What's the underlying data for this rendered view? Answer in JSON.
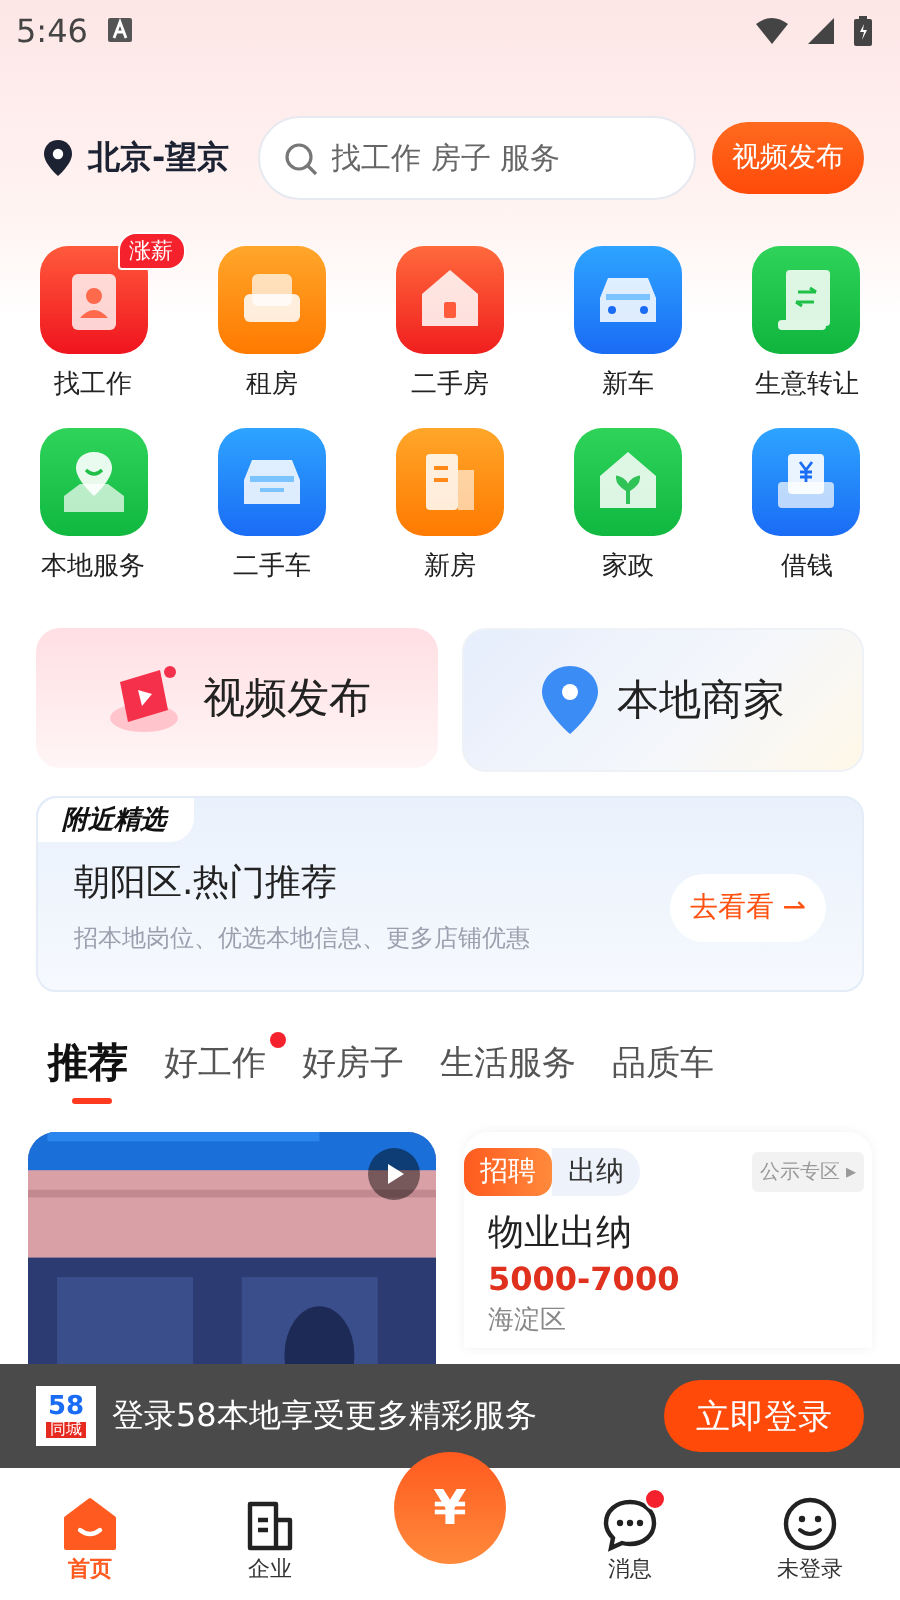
{
  "status_bar": {
    "time": "5:46"
  },
  "header": {
    "location": "北京-望京",
    "search": {
      "placeholder": "找工作 房子 服务"
    },
    "publish_button": "视频发布"
  },
  "services": [
    {
      "label": "找工作",
      "kind": "job",
      "badge": "涨薪"
    },
    {
      "label": "租房",
      "kind": "rent"
    },
    {
      "label": "二手房",
      "kind": "house"
    },
    {
      "label": "新车",
      "kind": "car"
    },
    {
      "label": "生意转让",
      "kind": "transfer"
    },
    {
      "label": "本地服务",
      "kind": "local"
    },
    {
      "label": "二手车",
      "kind": "usedcar"
    },
    {
      "label": "新房",
      "kind": "newhouse"
    },
    {
      "label": "家政",
      "kind": "homecare"
    },
    {
      "label": "借钱",
      "kind": "loan"
    }
  ],
  "feature_cards": [
    {
      "label": "视频发布",
      "kind": "video"
    },
    {
      "label": "本地商家",
      "kind": "merchant"
    }
  ],
  "nearby": {
    "tag": "附近精选",
    "title": "朝阳区.热门推荐",
    "subtitle": "招本地岗位、优选本地信息、更多店铺优惠",
    "action": "去看看 ⇀"
  },
  "tabs": [
    {
      "label": "推荐",
      "selected": true,
      "dot": false
    },
    {
      "label": "好工作",
      "selected": false,
      "dot": true
    },
    {
      "label": "好房子",
      "selected": false,
      "dot": false
    },
    {
      "label": "生活服务",
      "selected": false,
      "dot": false
    },
    {
      "label": "品质车",
      "selected": false,
      "dot": false
    }
  ],
  "feed": {
    "job": {
      "tags": [
        "招聘",
        "出纳"
      ],
      "zone": "公示专区 ▸",
      "title": "物业出纳",
      "salary": "5000-7000",
      "area": "海淀区"
    }
  },
  "login_banner": {
    "logo_number": "58",
    "logo_caption": "同城",
    "text": "登录58本地享受更多精彩服务",
    "button": "立即登录"
  },
  "bottom_nav": [
    {
      "label": "首页",
      "kind": "home",
      "selected": true,
      "dot": false
    },
    {
      "label": "企业",
      "kind": "company",
      "selected": false,
      "dot": false
    },
    {
      "label": "消息",
      "kind": "message",
      "selected": false,
      "dot": true
    },
    {
      "label": "未登录",
      "kind": "profile",
      "selected": false,
      "dot": false
    }
  ],
  "center_button": "¥"
}
